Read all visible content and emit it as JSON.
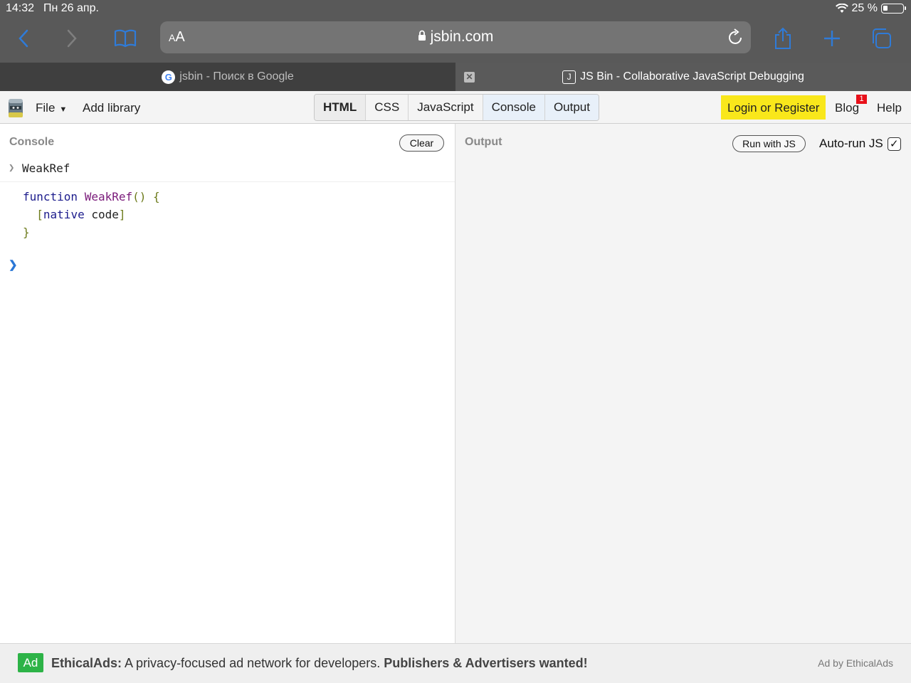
{
  "status": {
    "time": "14:32",
    "date": "Пн 26 апр.",
    "battery": "25 %",
    "battery_level": 0.25
  },
  "browser": {
    "address_text_size_label": "AA",
    "url": "jsbin.com",
    "tabs": [
      {
        "title": "jsbin - Поиск в Google",
        "active": false
      },
      {
        "title": "JS Bin - Collaborative JavaScript Debugging",
        "active": true
      }
    ],
    "accent_color": "#2f7bd8"
  },
  "jsbin": {
    "file_menu": "File",
    "add_library": "Add library",
    "panels": [
      {
        "label": "HTML",
        "state": "bold"
      },
      {
        "label": "CSS",
        "state": "normal"
      },
      {
        "label": "JavaScript",
        "state": "normal"
      },
      {
        "label": "Console",
        "state": "active"
      },
      {
        "label": "Output",
        "state": "active"
      }
    ],
    "login": "Login or Register",
    "blog": "Blog",
    "blog_badge": "1",
    "help": "Help"
  },
  "console": {
    "label": "Console",
    "clear_button": "Clear",
    "command": "WeakRef",
    "result": {
      "keyword": "function",
      "name": "WeakRef",
      "parens": "()",
      "open_brace": "{",
      "open_bracket": "[",
      "native": "native",
      "code": "code",
      "close_bracket": "]",
      "close_brace": "}"
    }
  },
  "output": {
    "label": "Output",
    "run_button": "Run with JS",
    "autorun_label": "Auto-run JS",
    "autorun_checked": true
  },
  "ad": {
    "badge": "Ad",
    "brand": "EthicalAds:",
    "text": " A privacy-focused ad network for developers. ",
    "cta": "Publishers & Advertisers wanted!",
    "by": "Ad by EthicalAds"
  }
}
